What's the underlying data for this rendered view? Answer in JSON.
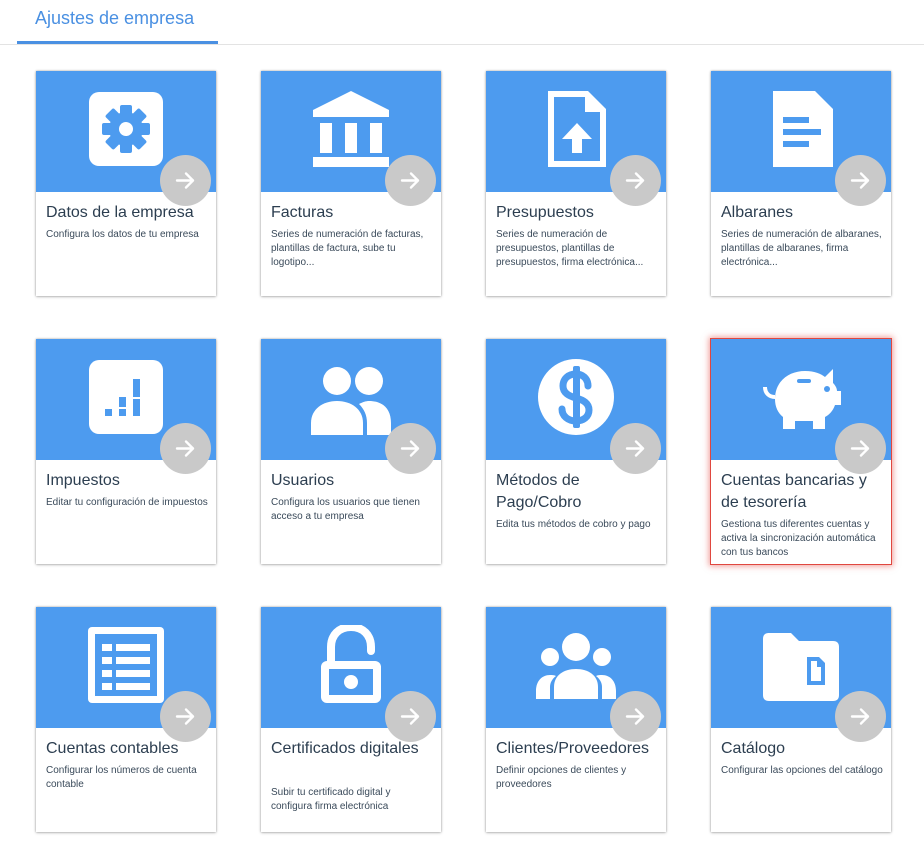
{
  "tab": {
    "label": "Ajustes de empresa"
  },
  "colors": {
    "accent": "#4a90e2",
    "tile": "#4d9bef",
    "arrow": "#c9c9c9",
    "selected_border": "#e0473f"
  },
  "cards": [
    {
      "title": "Datos de la empresa",
      "description": "Configura los datos de tu empresa",
      "icon": "gear-icon"
    },
    {
      "title": "Facturas",
      "description": "Series de numeración de facturas, plantillas de factura, sube tu logotipo...",
      "icon": "bank-icon"
    },
    {
      "title": "Presupuestos",
      "description": "Series de numeración de presupuestos, plantillas de presupuestos, firma electrónica...",
      "icon": "file-upload-icon"
    },
    {
      "title": "Albaranes",
      "description": "Series de numeración de albaranes, plantillas de albaranes, firma electrónica...",
      "icon": "document-icon"
    },
    {
      "title": "Impuestos",
      "description": "Editar tu configuración de impuestos",
      "icon": "chart-icon"
    },
    {
      "title": "Usuarios",
      "description": "Configura los usuarios que tienen acceso a tu empresa",
      "icon": "users-icon"
    },
    {
      "title": "Métodos de Pago/Cobro",
      "description": "Edita tus métodos de cobro y pago",
      "icon": "dollar-icon"
    },
    {
      "title": "Cuentas bancarias y de tesorería",
      "description": "Gestiona tus diferentes cuentas y activa la sincronización automática con tus bancos",
      "icon": "piggy-bank-icon",
      "selected": true
    },
    {
      "title": "Cuentas contables",
      "description": "Configurar los números de cuenta contable",
      "icon": "list-icon"
    },
    {
      "title": "Certificados digitales",
      "description": "Subir tu certificado digital y configura firma electrónica",
      "icon": "unlock-icon"
    },
    {
      "title": "Clientes/Proveedores",
      "description": "Definir opciones de clientes y proveedores",
      "icon": "group-icon"
    },
    {
      "title": "Catálogo",
      "description": "Configurar las opciones del catálogo",
      "icon": "folder-file-icon"
    }
  ]
}
